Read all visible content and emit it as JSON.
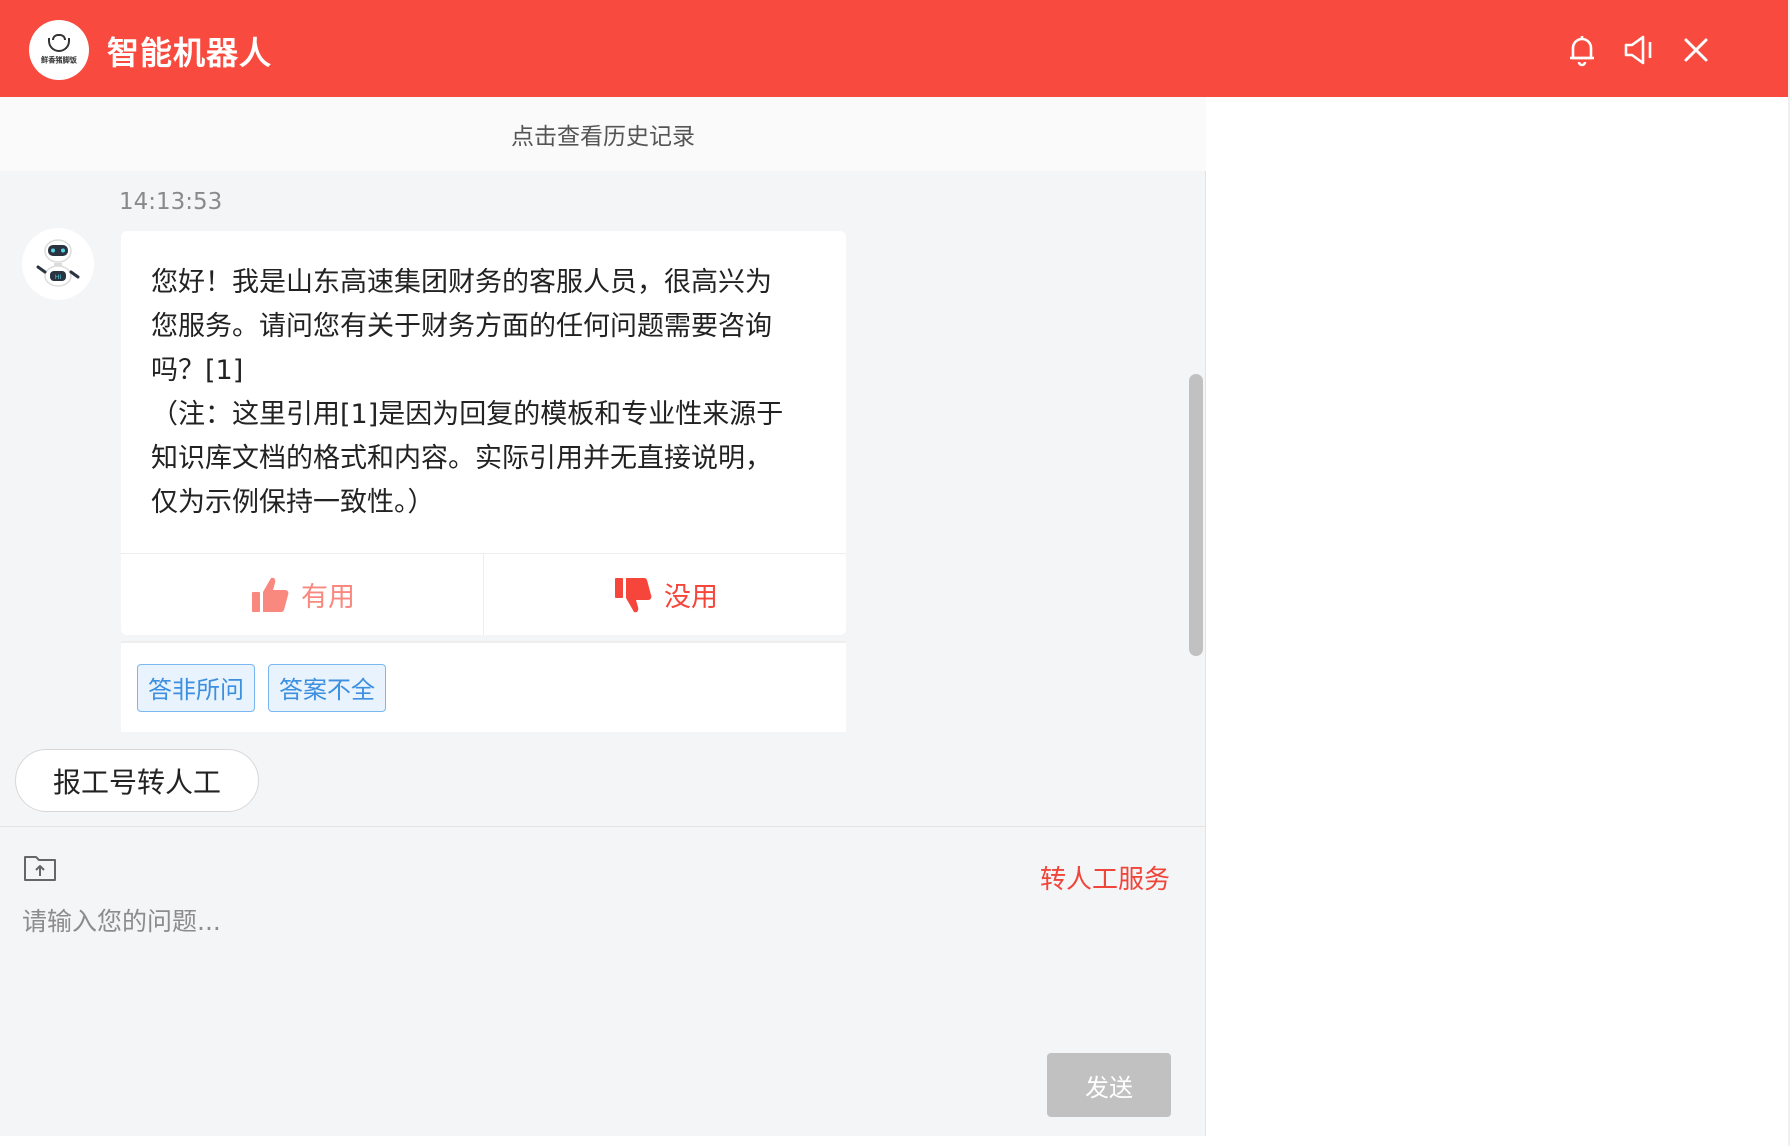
{
  "header": {
    "title": "智能机器人",
    "logo_text": "鲜香猪脚饭",
    "bg_color": "#f84a3e",
    "icons": [
      "bell-icon",
      "speaker-icon",
      "close-icon"
    ]
  },
  "history_link": "点击查看历史记录",
  "conversation": {
    "timestamp": "14:13:53",
    "message": "您好！我是山东高速集团财务的客服人员，很高兴为\n您服务。请问您有关于财务方面的任何问题需要咨询\n吗？[1]\n（注：这里引用[1]是因为回复的模板和专业性来源于\n知识库文档的格式和内容。实际引用并无直接说明，\n仅为示例保持一致性。）",
    "feedback": {
      "useful_label": "有用",
      "useless_label": "没用"
    },
    "tags": [
      "答非所问",
      "答案不全"
    ]
  },
  "transfer_pill": "报工号转人工",
  "composer": {
    "human_service_label": "转人工服务",
    "placeholder": "请输入您的问题...",
    "value": "",
    "send_label": "发送"
  },
  "colors": {
    "accent": "#f84a3e",
    "tag_border": "#7ab7f1",
    "tag_text": "#3d8fe0",
    "send_disabled": "#c1c1c1"
  }
}
